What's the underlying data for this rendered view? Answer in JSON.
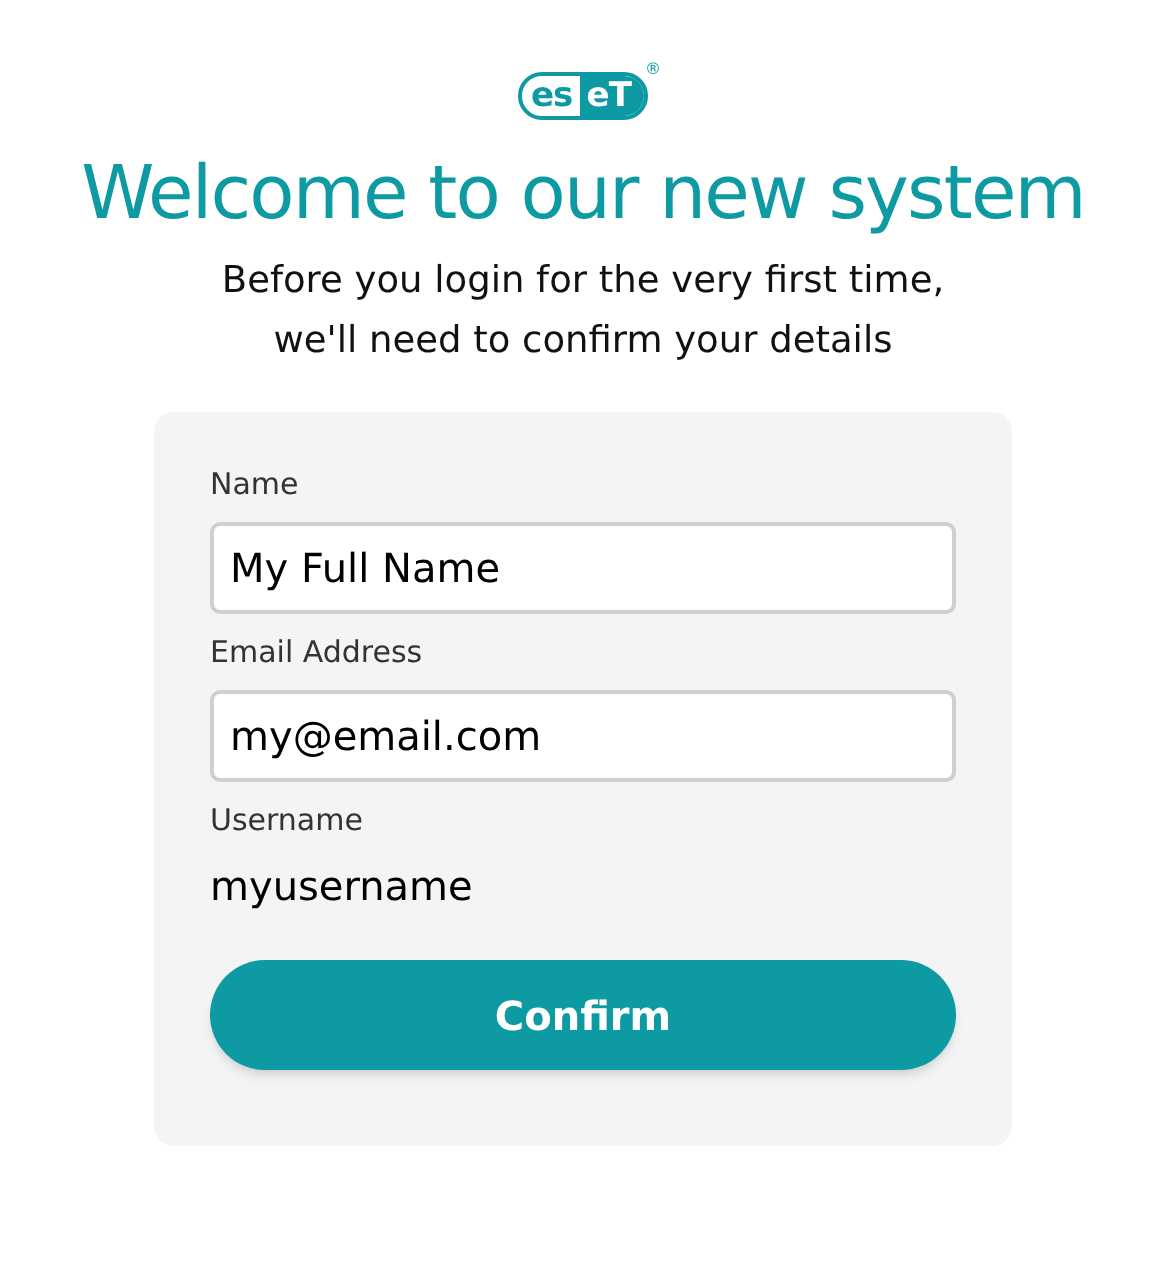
{
  "logo": {
    "outlined_part": "es",
    "filled_part": "eT",
    "registered_mark": "®"
  },
  "title": "Welcome to our new system",
  "subtitle_lines": [
    "Before you login for the very first time,",
    "we'll need to confirm your details"
  ],
  "form": {
    "fields": [
      {
        "kind": "input",
        "label": "Name",
        "value": "My Full Name"
      },
      {
        "kind": "input",
        "label": "Email Address",
        "value": "my@email.com"
      },
      {
        "kind": "static",
        "label": "Username",
        "value": "myusername"
      }
    ],
    "button": "Confirm"
  }
}
